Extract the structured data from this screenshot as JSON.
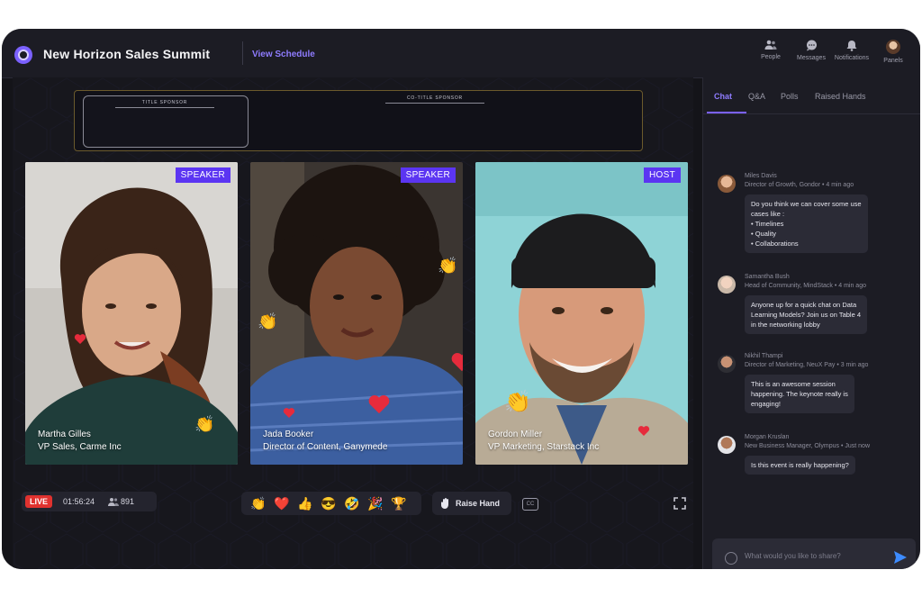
{
  "header": {
    "event_title": "New Horizon Sales Summit",
    "view_schedule": "View Schedule",
    "icons": [
      {
        "icon": "people-icon",
        "label": "People"
      },
      {
        "icon": "messages-icon",
        "label": "Messages"
      },
      {
        "icon": "bell-icon",
        "label": "Notifications"
      },
      {
        "icon": "avatar",
        "label": "Panels"
      }
    ]
  },
  "sponsors": {
    "title_label": "TITLE SPONSOR",
    "co_title_label": "CO-TITLE SPONSOR"
  },
  "participants": [
    {
      "role": "SPEAKER",
      "name": "Martha Gilles",
      "title": "VP Sales, Carme Inc"
    },
    {
      "role": "SPEAKER",
      "name": "Jada Booker",
      "title": "Director of Content, Ganymede"
    },
    {
      "role": "HOST",
      "name": "Gordon Miller",
      "title": "VP Marketing, Starstack Inc"
    }
  ],
  "controls": {
    "live": "LIVE",
    "timer": "01:56:24",
    "viewers": "891",
    "reactions": [
      "👏",
      "❤️",
      "👍",
      "😎",
      "🤣",
      "🎉",
      "🏆"
    ],
    "raise_hand": "Raise Hand",
    "cc": "CC"
  },
  "sidebar": {
    "tabs": [
      "Chat",
      "Q&A",
      "Polls",
      "Raised Hands"
    ],
    "active_tab": "Chat",
    "messages": [
      {
        "author": "Miles Davis",
        "meta": "Director of Growth, Gondor • 4 min ago",
        "lines": [
          "Do you think we can cover some use",
          "cases like :",
          "• Timelines",
          "• Quality",
          "• Collaborations"
        ]
      },
      {
        "author": "Samantha Bush",
        "meta": "Head of Community, MindStack • 4 min ago",
        "lines": [
          "Anyone up for a quick chat on Data",
          "Learning Models? Join us on Table 4",
          "in the networking lobby"
        ]
      },
      {
        "author": "Nikhil Thampi",
        "meta": "Director of Marketing, NeuX Pay • 3 min ago",
        "lines": [
          "This is an awesome session",
          "happening. The keynote really is",
          "engaging!"
        ]
      },
      {
        "author": "Morgan Kruslan",
        "meta": "New Business Manager, Olympus • Just now",
        "lines": [
          "Is this event is really happening?"
        ]
      }
    ],
    "input_placeholder": "What would you like to share?"
  },
  "colors": {
    "accent": "#7b61ff",
    "live": "#e0322f",
    "badge": "#5b35f2",
    "background": "#141419"
  }
}
